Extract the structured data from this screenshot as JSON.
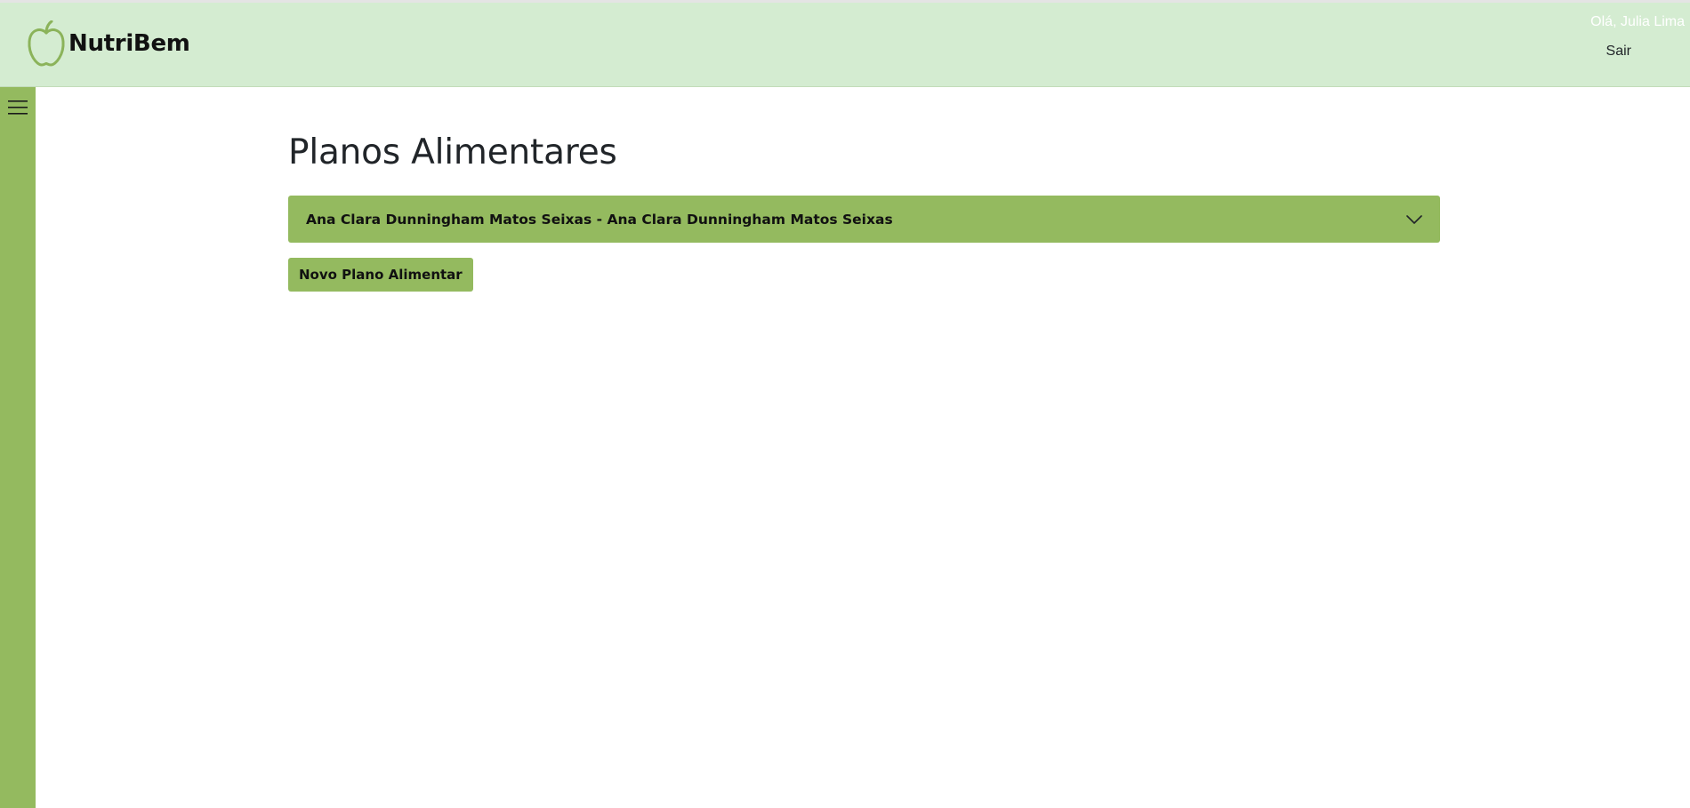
{
  "header": {
    "brand": "NutriBem",
    "greeting": "Olá, Julia Lima",
    "logout_label": "Sair"
  },
  "sidebar": {
    "menu_icon": "hamburger-menu-icon"
  },
  "main": {
    "title": "Planos Alimentares",
    "plans": [
      {
        "label": "Ana Clara Dunningham Matos Seixas - Ana Clara Dunningham Matos Seixas",
        "expanded": false
      }
    ],
    "new_plan_label": "Novo Plano Alimentar"
  },
  "colors": {
    "header_bg": "#d4ecd1",
    "accent_green": "#94ba5f",
    "apple_icon": "#8bb35a",
    "text_dark": "#212529"
  }
}
